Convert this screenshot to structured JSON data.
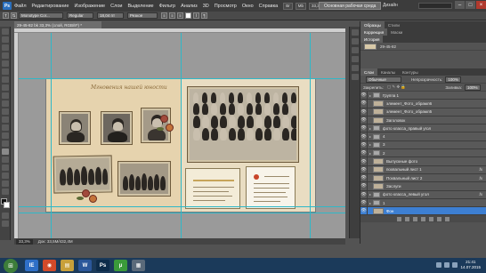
{
  "menubar": {
    "logo": "Ps",
    "items": [
      "Файл",
      "Редактирование",
      "Изображение",
      "Слои",
      "Выделение",
      "Фильтр",
      "Анализ",
      "3D",
      "Просмотр",
      "Окно",
      "Справка"
    ],
    "quick_buttons": [
      "Br",
      "Mb"
    ],
    "zoom": "33,3",
    "workspace_button": "Основная рабочая среда",
    "design_label": "Дизайн",
    "window_controls": [
      "–",
      "□",
      "×"
    ]
  },
  "options_bar": {
    "tool_icon": "T",
    "font_family": "Monotype Cor...",
    "font_style": "Regular",
    "font_size": "18,04 пт",
    "antialias": "Резкое",
    "color_hex": "#ffffff"
  },
  "document": {
    "tab_title": "29-45-82 bk 33,3% (слой, RGB/8*) *",
    "zoom": "33,3%",
    "doc_info": "Док: 33,5М/432,4М"
  },
  "artboard": {
    "left_page_title": "Мгновения нашей юности"
  },
  "panels": {
    "top_tabs": [
      "Образцы",
      "Стили"
    ],
    "mid_tabs": [
      "Коррекция",
      "Маски"
    ],
    "history_tab": "История",
    "history_item": "29-45-82",
    "layer_tabs": [
      "Слои",
      "Каналы",
      "Контуры"
    ],
    "blend_mode": "Обычные",
    "opacity_label": "Непрозрачность:",
    "opacity_value": "100%",
    "lock_label": "Закрепить:",
    "fill_label": "Заливка:",
    "fill_value": "100%",
    "layers": [
      {
        "name": "Группа 1",
        "kind": "folder",
        "fx": false,
        "selected": false
      },
      {
        "name": "элемент_Фото_обрамл6",
        "kind": "layer",
        "fx": false,
        "selected": false
      },
      {
        "name": "элемент_Фото_обрамл5",
        "kind": "layer",
        "fx": false,
        "selected": false
      },
      {
        "name": "Заголовок",
        "kind": "layer",
        "fx": false,
        "selected": false
      },
      {
        "name": "фото класса_правый угол",
        "kind": "folder",
        "fx": false,
        "selected": false
      },
      {
        "name": "4",
        "kind": "folder",
        "fx": false,
        "selected": false
      },
      {
        "name": "3",
        "kind": "folder",
        "fx": false,
        "selected": false
      },
      {
        "name": "2",
        "kind": "folder",
        "fx": false,
        "selected": false
      },
      {
        "name": "Выпускные фото",
        "kind": "layer",
        "fx": false,
        "selected": false
      },
      {
        "name": "похвальный лист 1",
        "kind": "layer",
        "fx": true,
        "selected": false
      },
      {
        "name": "Похвальный лист 2",
        "kind": "layer",
        "fx": true,
        "selected": false
      },
      {
        "name": "Заслуги",
        "kind": "layer",
        "fx": false,
        "selected": false
      },
      {
        "name": "фото класса_левый угол",
        "kind": "folder",
        "fx": true,
        "selected": false
      },
      {
        "name": "1",
        "kind": "folder",
        "fx": false,
        "selected": false
      },
      {
        "name": "Фон",
        "kind": "layer",
        "fx": false,
        "selected": true
      }
    ]
  },
  "taskbar": {
    "start": "⊞",
    "apps": [
      {
        "label": "IE",
        "color": "#2f6fc7"
      },
      {
        "label": "◉",
        "color": "#d24a2a"
      },
      {
        "label": "▤",
        "color": "#c8a03a"
      },
      {
        "label": "W",
        "color": "#2b579a"
      },
      {
        "label": "Ps",
        "color": "#0d2c4a"
      },
      {
        "label": "µ",
        "color": "#3a9a3a"
      },
      {
        "label": "▦",
        "color": "#5a6a7a"
      }
    ],
    "time": "21:41",
    "date": "14.07.2015"
  }
}
